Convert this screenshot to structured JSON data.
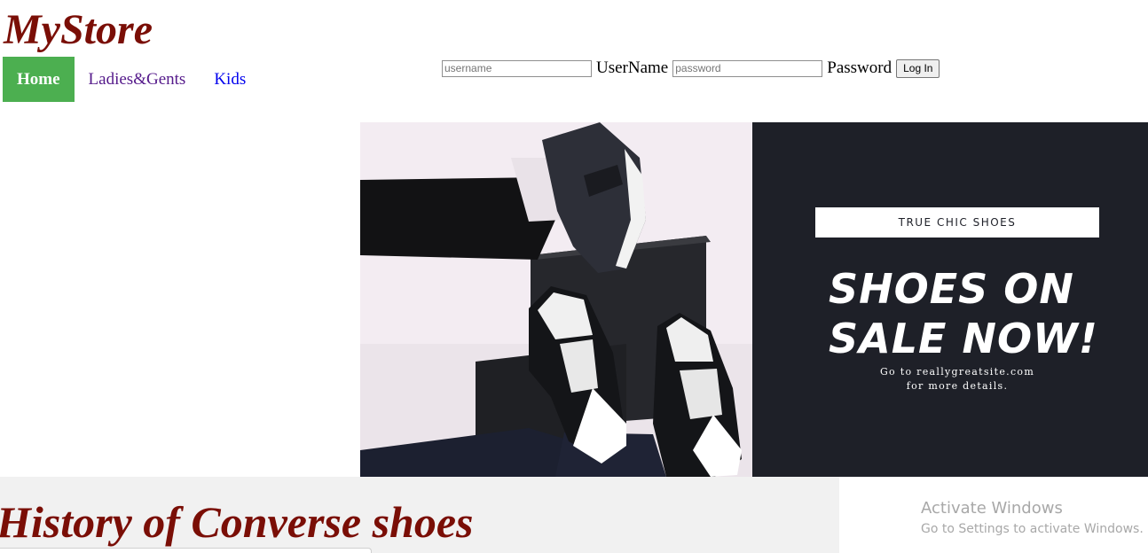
{
  "brand": {
    "title": "MyStore"
  },
  "nav": {
    "items": [
      {
        "label": "Home",
        "state": "active"
      },
      {
        "label": "Ladies&Gents",
        "state": "visited"
      },
      {
        "label": "Kids",
        "state": "link"
      }
    ]
  },
  "login": {
    "username_placeholder": "username",
    "username_label": "UserName",
    "password_placeholder": "password",
    "password_label": "Password",
    "button_label": "Log In"
  },
  "banner": {
    "badge": "TRUE CHIC SHOES",
    "headline_line1": "SHOES ON",
    "headline_line2": "SALE NOW!",
    "details_line1": "Go to reallygreatsite.com",
    "details_line2": "for more details."
  },
  "article": {
    "title": "History of Converse shoes"
  },
  "watermark": {
    "line1": "Activate Windows",
    "line2": "Go to Settings to activate Windows."
  },
  "colors": {
    "brand": "#7a0e06",
    "nav_active": "#4caf50",
    "promo_bg": "#1e2028",
    "history_bg": "#f1f1f1"
  }
}
